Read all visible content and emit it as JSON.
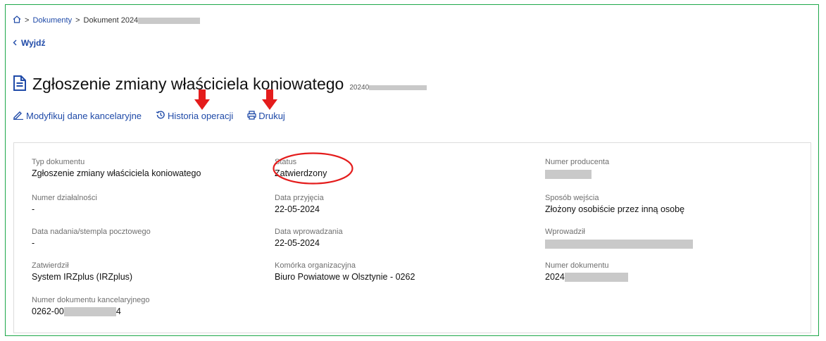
{
  "breadcrumb": {
    "home": "home-icon",
    "sep": ">",
    "documents": "Dokumenty",
    "current": "Dokument 2024"
  },
  "back": {
    "label": "Wyjdź"
  },
  "title": {
    "text": "Zgłoszenie zmiany właściciela koniowatego",
    "number_prefix": "20240"
  },
  "actions": {
    "modify": "Modyfikuj dane kancelaryjne",
    "history": "Historia operacji",
    "print": "Drukuj"
  },
  "fields": {
    "typ_label": "Typ dokumentu",
    "typ_value": "Zgłoszenie zmiany właściciela koniowatego",
    "status_label": "Status",
    "status_value": "Zatwierdzony",
    "producent_label": "Numer producenta",
    "dzialalnosc_label": "Numer działalności",
    "dzialalnosc_value": "-",
    "przyjecie_label": "Data przyjęcia",
    "przyjecie_value": "22-05-2024",
    "sposob_label": "Sposób wejścia",
    "sposob_value": "Złożony osobiście przez inną osobę",
    "nadanie_label": "Data nadania/stempla pocztowego",
    "nadanie_value": "-",
    "wprowadzania_label": "Data wprowadzania",
    "wprowadzania_value": "22-05-2024",
    "wprowadzil_label": "Wprowadził",
    "zatwierdzil_label": "Zatwierdził",
    "zatwierdzil_value": "System IRZplus (IRZplus)",
    "komorka_label": "Komórka organizacyjna",
    "komorka_value": "Biuro Powiatowe w Olsztynie - 0262",
    "numer_dok_label": "Numer dokumentu",
    "numer_dok_value": "2024",
    "kanc_label": "Numer dokumentu kancelaryjnego",
    "kanc_prefix": "0262-00",
    "kanc_suffix": "4"
  },
  "colors": {
    "link": "#1f4aa8",
    "annotation": "#e41c1c",
    "frame": "#1ea84a",
    "redaction": "#c9c9c9"
  }
}
